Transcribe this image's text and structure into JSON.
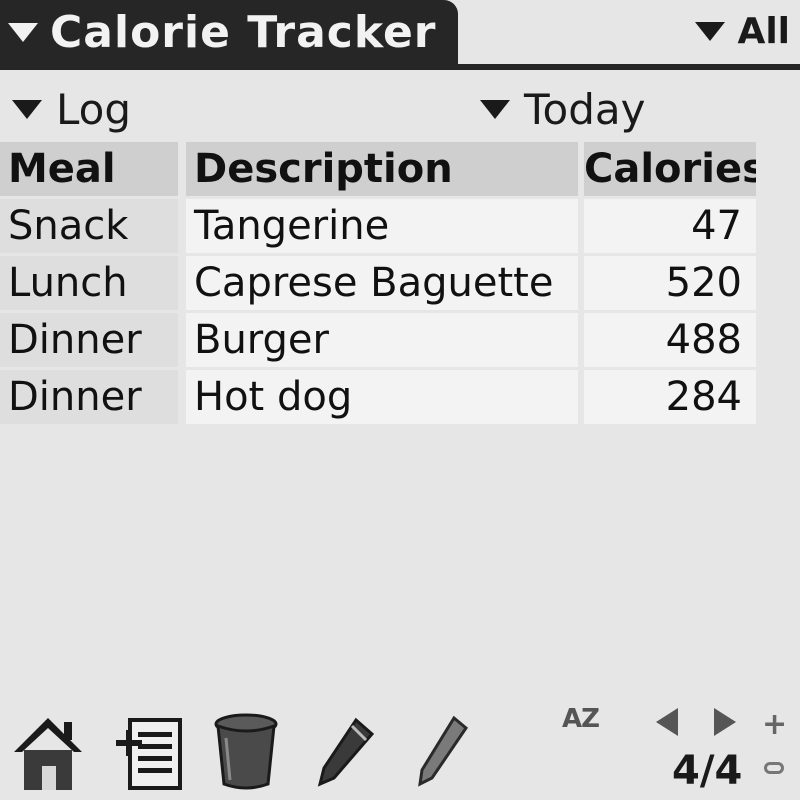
{
  "app": {
    "title": "Calorie Tracker",
    "category": "All"
  },
  "pickers": {
    "view": "Log",
    "period": "Today"
  },
  "table": {
    "columns": [
      "Meal",
      "Description",
      "Calories"
    ],
    "rows": [
      {
        "meal": "Snack",
        "description": "Tangerine",
        "calories": "47"
      },
      {
        "meal": "Lunch",
        "description": "Caprese Baguette",
        "calories": "520"
      },
      {
        "meal": "Dinner",
        "description": "Burger",
        "calories": "488"
      },
      {
        "meal": "Dinner",
        "description": "Hot dog",
        "calories": "284"
      }
    ]
  },
  "toolbar": {
    "icons": [
      "home-icon",
      "add-entry-icon",
      "delete-icon",
      "edit-icon",
      "note-icon"
    ],
    "sort_label": "AZ",
    "page_indicator": "4/4"
  },
  "colors": {
    "title_bar": "#262626",
    "background": "#e6e6e6",
    "header_cell": "#cfcfcf",
    "text": "#111111"
  }
}
